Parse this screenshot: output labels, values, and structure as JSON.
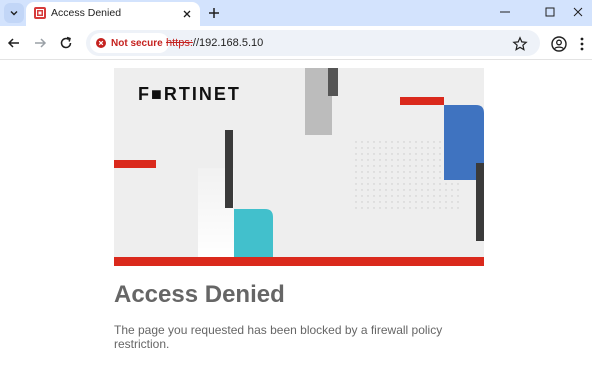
{
  "browser": {
    "tab": {
      "title": "Access Denied"
    },
    "address": {
      "security_label": "Not secure",
      "url_scheme": "https:",
      "url_rest": "//192.168.5.10"
    }
  },
  "page": {
    "logo": "F■RTINET",
    "heading": "Access Denied",
    "message": "The page you requested has been blocked by a firewall policy restriction."
  },
  "colors": {
    "tabstrip": "#d3e3fd",
    "brand_red": "#da291c",
    "accent_blue": "#3f73c0",
    "accent_teal": "#42c0cc",
    "text_gray": "#666666"
  }
}
